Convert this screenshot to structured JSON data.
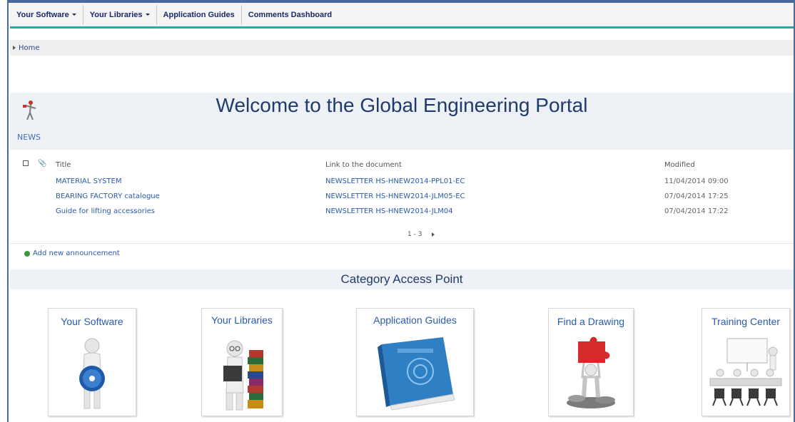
{
  "nav": {
    "items": [
      {
        "label": "Your Software",
        "dropdown": true
      },
      {
        "label": "Your Libraries",
        "dropdown": true
      },
      {
        "label": "Application Guides",
        "dropdown": false
      },
      {
        "label": "Comments Dashboard",
        "dropdown": false
      }
    ]
  },
  "breadcrumb": {
    "home": "Home"
  },
  "welcome": {
    "title": "Welcome to the Global Engineering Portal",
    "section": "NEWS"
  },
  "news": {
    "columns": {
      "title": "Title",
      "link": "Link to the document",
      "modified": "Modified"
    },
    "rows": [
      {
        "title": "MATERIAL SYSTEM",
        "link": "NEWSLETTER HS-HNEW2014-PPL01-EC",
        "modified": "11/04/2014 09:00"
      },
      {
        "title": "BEARING FACTORY catalogue",
        "link": "NEWSLETTER HS-HNEW2014-JLM05-EC",
        "modified": "07/04/2014 17:25"
      },
      {
        "title": "Guide for lifting accessories",
        "link": "NEWSLETTER HS-HNEW2014-JLM04",
        "modified": "07/04/2014 17:22"
      }
    ],
    "pager": "1 - 3",
    "add_label": "Add new announcement"
  },
  "categories": {
    "title": "Category Access Point",
    "tiles": [
      {
        "label": "Your Software",
        "icon": "software-cd-icon"
      },
      {
        "label": "Your Libraries",
        "icon": "library-books-icon"
      },
      {
        "label": "Application Guides",
        "icon": "technology-book-icon"
      },
      {
        "label": "Find a Drawing",
        "icon": "puzzle-piece-icon"
      },
      {
        "label": "Training Center",
        "icon": "training-room-icon"
      }
    ]
  },
  "colors": {
    "accent": "#2aa8a2",
    "nav_text": "#1a2a66",
    "link": "#2a5aa8",
    "title": "#1f3b6c"
  }
}
